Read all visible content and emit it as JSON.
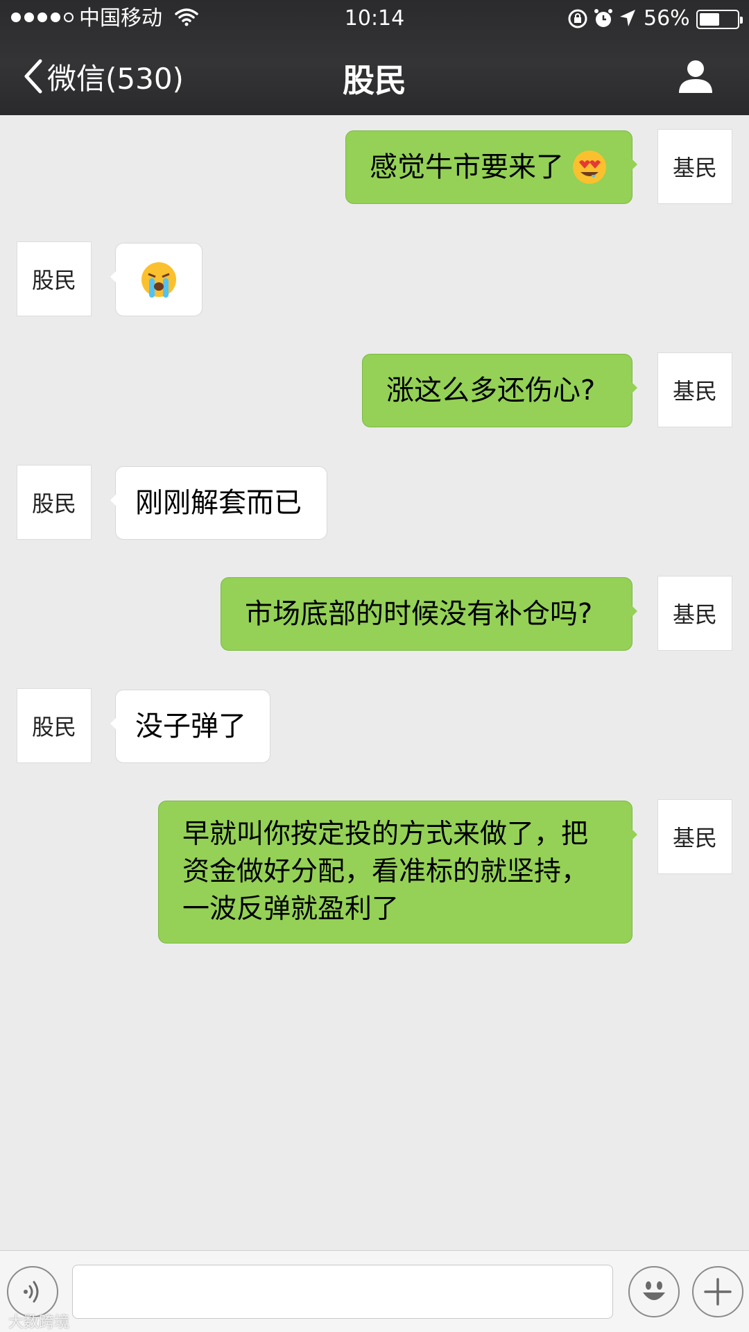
{
  "status_bar": {
    "carrier": "中国移动",
    "time": "10:14",
    "battery_percent": "56%",
    "battery_level": 0.56
  },
  "nav": {
    "back_label": "微信(530)",
    "title": "股民",
    "icons": [
      "chevron-left-icon",
      "person-icon"
    ]
  },
  "messages": [
    {
      "sender": "me",
      "avatar": "基民",
      "text": "感觉牛市要来了",
      "emoji": "heart-eyes-drooling"
    },
    {
      "sender": "them",
      "avatar": "股民",
      "text": "",
      "emoji": "crying"
    },
    {
      "sender": "me",
      "avatar": "基民",
      "text": "涨这么多还伤心?"
    },
    {
      "sender": "them",
      "avatar": "股民",
      "text": "刚刚解套而已"
    },
    {
      "sender": "me",
      "avatar": "基民",
      "text": "市场底部的时候没有补仓吗?"
    },
    {
      "sender": "them",
      "avatar": "股民",
      "text": "没子弹了"
    },
    {
      "sender": "me",
      "avatar": "基民",
      "text": "早就叫你按定投的方式来做了，把\n资金做好分配，看准标的就坚持，\n一波反弹就盈利了"
    }
  ],
  "input_bar": {
    "placeholder": "",
    "icons": [
      "voice-icon",
      "emoji-icon",
      "plus-icon"
    ]
  },
  "watermark": "大数跨境",
  "colors": {
    "my_bubble": "#94d156",
    "their_bubble": "#ffffff",
    "background": "#ebebeb",
    "header": "#2f2f31"
  }
}
